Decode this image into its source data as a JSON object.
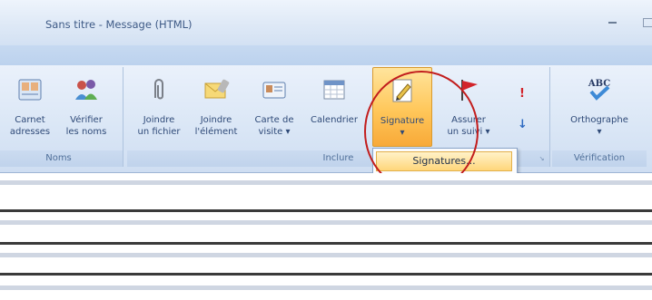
{
  "window": {
    "title": "Sans titre - Message (HTML)"
  },
  "ribbon": {
    "groups": [
      {
        "name": "Noms",
        "buttons": [
          {
            "line1": "Carnet",
            "line2": "adresses",
            "icon": "address-book-icon"
          },
          {
            "line1": "Vérifier",
            "line2": "les noms",
            "icon": "check-names-icon"
          }
        ]
      },
      {
        "name": "Inclure",
        "buttons": [
          {
            "line1": "Joindre",
            "line2": "un fichier",
            "icon": "paperclip-icon"
          },
          {
            "line1": "Joindre",
            "line2": "l'élément",
            "icon": "envelope-icon"
          },
          {
            "line1": "Carte de",
            "line2": "visite ▾",
            "icon": "business-card-icon"
          },
          {
            "line1": "Calendrier",
            "line2": "",
            "icon": "calendar-icon"
          },
          {
            "line1": "Signature",
            "line2": "▾",
            "icon": "signature-pen-icon"
          },
          {
            "line1": "Assurer",
            "line2": "un suivi ▾",
            "icon": "follow-up-flag-icon"
          }
        ],
        "side_buttons": [
          {
            "icon": "high-importance-icon",
            "symbol": "!"
          },
          {
            "icon": "low-importance-icon",
            "symbol": "↓"
          }
        ]
      },
      {
        "name": "Vérification",
        "buttons": [
          {
            "line1": "Orthographe",
            "line2": "▾",
            "icon": "spelling-abc-icon"
          }
        ]
      }
    ]
  },
  "signature_menu": {
    "item": "Signatures..."
  },
  "colors": {
    "accent_highlight": "#ffc75a",
    "annotation_circle": "#c21d1d",
    "label_text": "#2f4a78"
  }
}
